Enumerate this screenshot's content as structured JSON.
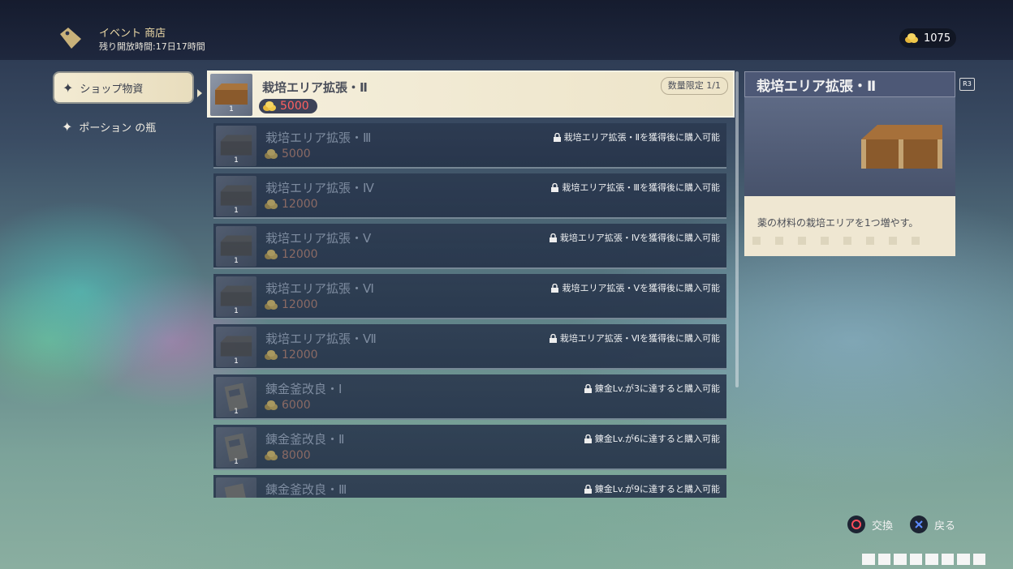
{
  "header": {
    "title": "イベント 商店",
    "time_remaining": "残り開放時間:17日17時間",
    "currency_amount": "1075"
  },
  "categories": [
    {
      "label": "ショップ物資",
      "active": true
    },
    {
      "label": "ポーション の瓶",
      "active": false
    }
  ],
  "items": [
    {
      "name": "栽培エリア拡張・Ⅱ",
      "price": "5000",
      "qty": "1",
      "limit": "数量限定 1/1",
      "lock": "",
      "icon": "crate-icon"
    },
    {
      "name": "栽培エリア拡張・Ⅲ",
      "price": "5000",
      "qty": "1",
      "limit": "",
      "lock": "栽培エリア拡張・Ⅱを獲得後に購入可能",
      "icon": "crate-icon"
    },
    {
      "name": "栽培エリア拡張・Ⅳ",
      "price": "12000",
      "qty": "1",
      "limit": "",
      "lock": "栽培エリア拡張・Ⅲを獲得後に購入可能",
      "icon": "crate-icon"
    },
    {
      "name": "栽培エリア拡張・Ⅴ",
      "price": "12000",
      "qty": "1",
      "limit": "",
      "lock": "栽培エリア拡張・Ⅳを獲得後に購入可能",
      "icon": "crate-icon"
    },
    {
      "name": "栽培エリア拡張・Ⅵ",
      "price": "12000",
      "qty": "1",
      "limit": "",
      "lock": "栽培エリア拡張・Ⅴを獲得後に購入可能",
      "icon": "crate-icon"
    },
    {
      "name": "栽培エリア拡張・Ⅶ",
      "price": "12000",
      "qty": "1",
      "limit": "",
      "lock": "栽培エリア拡張・Ⅵを獲得後に購入可能",
      "icon": "crate-icon"
    },
    {
      "name": "錬金釜改良・Ⅰ",
      "price": "6000",
      "qty": "1",
      "limit": "",
      "lock": "錬金Lv.が3に達すると購入可能",
      "icon": "scroll-icon"
    },
    {
      "name": "錬金釜改良・Ⅱ",
      "price": "8000",
      "qty": "1",
      "limit": "",
      "lock": "錬金Lv.が6に達すると購入可能",
      "icon": "scroll-icon"
    },
    {
      "name": "錬金釜改良・Ⅲ",
      "price": "",
      "qty": "",
      "limit": "",
      "lock": "錬金Lv.が9に達すると購入可能",
      "icon": "scroll-icon"
    }
  ],
  "detail": {
    "title": "栽培エリア拡張・Ⅱ",
    "description": "薬の材料の栽培エリアを1つ増やす。",
    "r3_label": "R3"
  },
  "hints": {
    "exchange": "交換",
    "back": "戻る"
  },
  "colors": {
    "accent_gold": "#ecd9a6",
    "price_red": "#ff6060",
    "panel_dark": "#2c3a50",
    "panel_light": "#f5efdd"
  }
}
